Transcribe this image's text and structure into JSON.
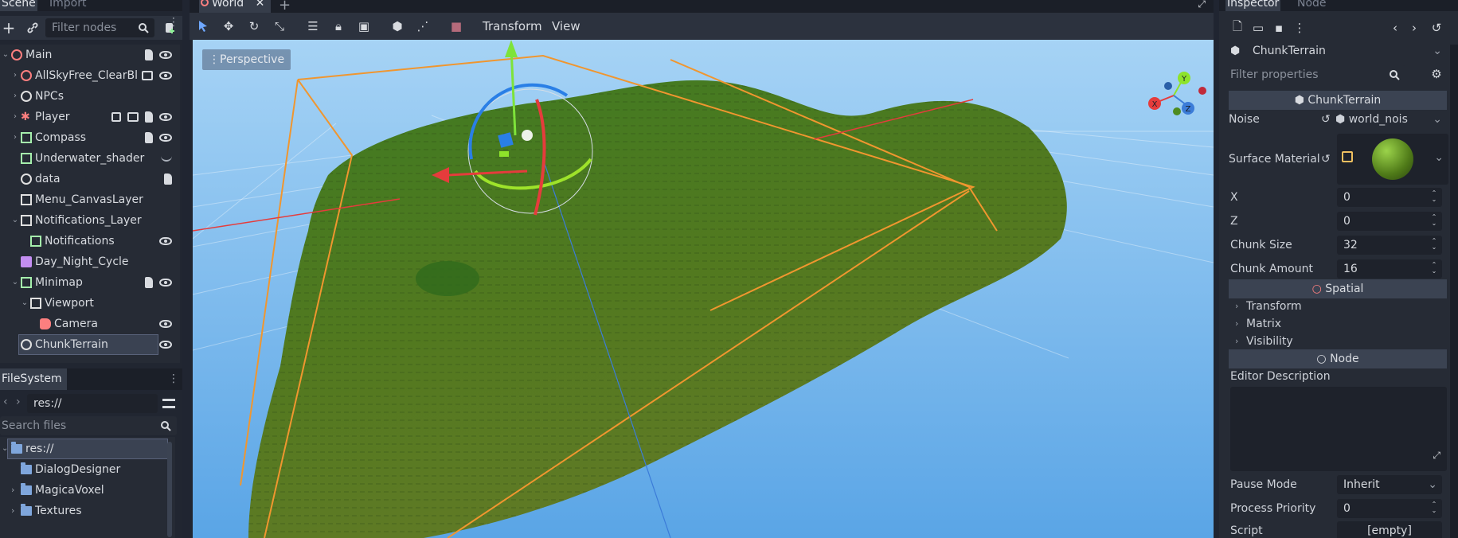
{
  "scene_dock": {
    "tabs": [
      "Scene",
      "Import"
    ],
    "filter_placeholder": "Filter nodes",
    "nodes": [
      {
        "label": "Main",
        "icon": "spatial-icon",
        "color": "#fc7f7f"
      },
      {
        "label": "AllSkyFree_ClearBl",
        "icon": "spatial-icon",
        "color": "#fc7f7f"
      },
      {
        "label": "NPCs",
        "icon": "node-icon",
        "color": "#e0e0e0"
      },
      {
        "label": "Player",
        "icon": "kinematic-body-icon",
        "color": "#fc7f7f"
      },
      {
        "label": "Compass",
        "icon": "texture-rect-icon",
        "color": "#a5efac"
      },
      {
        "label": "Underwater_shader",
        "icon": "texture-rect-icon",
        "color": "#a5efac"
      },
      {
        "label": "data",
        "icon": "node-icon",
        "color": "#e0e0e0"
      },
      {
        "label": "Menu_CanvasLayer",
        "icon": "canvas-layer-icon",
        "color": "#e0e0e0"
      },
      {
        "label": "Notifications_Layer",
        "icon": "canvas-layer-icon",
        "color": "#e0e0e0"
      },
      {
        "label": "Notifications",
        "icon": "vbox-icon",
        "color": "#a5efac"
      },
      {
        "label": "Day_Night_Cycle",
        "icon": "animation-player-icon",
        "color": "#c38ef1"
      },
      {
        "label": "Minimap",
        "icon": "viewport-container-icon",
        "color": "#a5efac"
      },
      {
        "label": "Viewport",
        "icon": "viewport-icon",
        "color": "#e0e0e0"
      },
      {
        "label": "Camera",
        "icon": "camera-icon",
        "color": "#fc7f7f"
      },
      {
        "label": "ChunkTerrain",
        "icon": "node-icon",
        "color": "#e0e0e0"
      }
    ]
  },
  "filesystem": {
    "tab": "FileSystem",
    "path": "res://",
    "search_placeholder": "Search files",
    "items": [
      "res://",
      "DialogDesigner",
      "MagicaVoxel",
      "Textures"
    ]
  },
  "viewport": {
    "tab": "World",
    "menus": [
      "Transform",
      "View"
    ],
    "perspective_label": "Perspective",
    "gizmo_axes": [
      "X",
      "Y",
      "Z"
    ]
  },
  "inspector": {
    "tabs": [
      "Inspector",
      "Node"
    ],
    "object_name": "ChunkTerrain",
    "filter_placeholder": "Filter properties",
    "class_header": "ChunkTerrain",
    "noise_label": "Noise",
    "noise_value": "world_nois",
    "surface_material_label": "Surface Material",
    "props": [
      {
        "label": "X",
        "value": "0"
      },
      {
        "label": "Z",
        "value": "0"
      },
      {
        "label": "Chunk Size",
        "value": "32"
      },
      {
        "label": "Chunk Amount",
        "value": "16"
      }
    ],
    "spatial_header": "Spatial",
    "spatial_sections": [
      "Transform",
      "Matrix",
      "Visibility"
    ],
    "node_header": "Node",
    "editor_description_label": "Editor Description",
    "pause_mode_label": "Pause Mode",
    "pause_mode_value": "Inherit",
    "process_priority_label": "Process Priority",
    "process_priority_value": "0",
    "script_label": "Script",
    "script_value": "[empty]"
  },
  "colors": {
    "accent": "#6fa8ff",
    "spatial": "#fc7f7f",
    "control": "#a5efac",
    "sky_top": "#9fd0f5",
    "sky_bottom": "#5da7e6",
    "terrain": "#4f7a2a"
  }
}
